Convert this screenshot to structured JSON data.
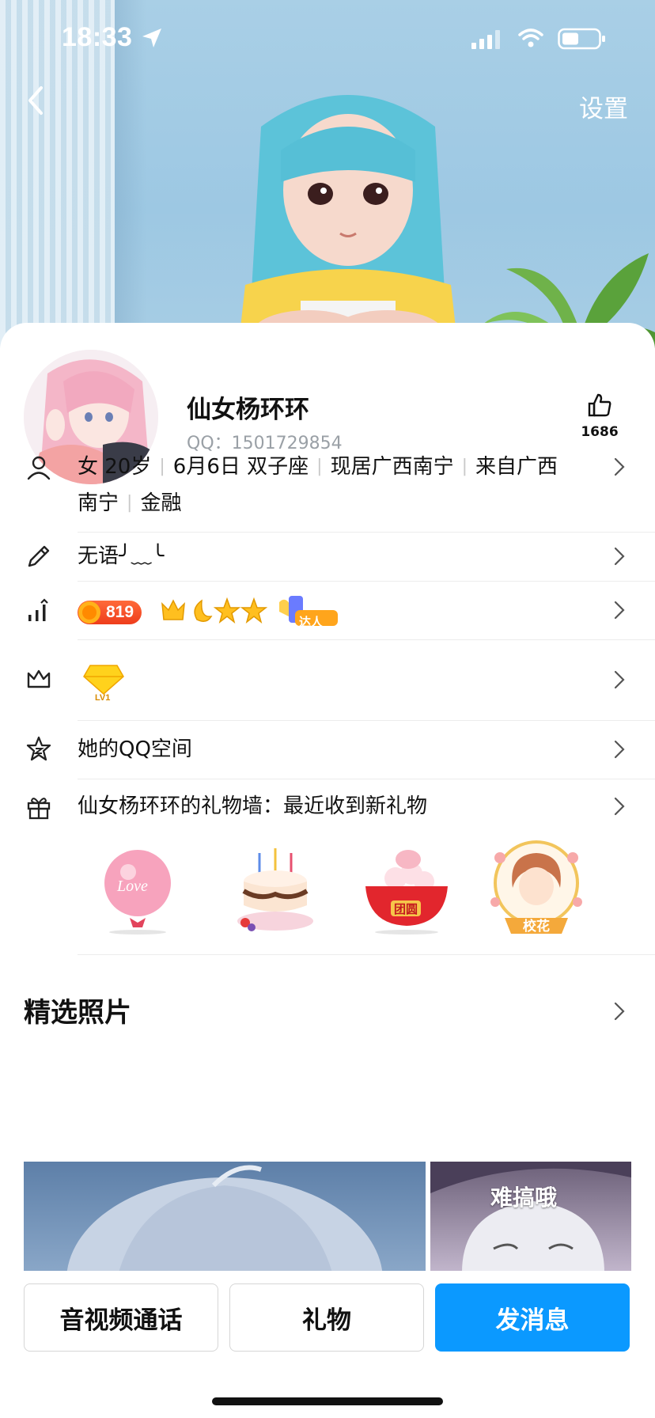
{
  "status_bar": {
    "time": "18:33"
  },
  "header": {
    "settings_label": "设置"
  },
  "profile": {
    "nickname": "仙女杨环环",
    "qq_label": "QQ：1501729854",
    "likes": "1686"
  },
  "info": {
    "parts": [
      "女 20岁",
      "6月6日 双子座",
      "现居广西南宁",
      "来自广西"
    ],
    "parts_line2": [
      "南宁",
      "金融"
    ]
  },
  "signature": "无语╯﹏╰",
  "level": {
    "value": "819",
    "talent_label": "达人",
    "vip_label": "LV1"
  },
  "qzone_label": "她的QQ空间",
  "gift_wall": {
    "title": "仙女杨环环的礼物墙：最近收到新礼物",
    "items": [
      {
        "name": "love-balloon",
        "text": "Love"
      },
      {
        "name": "birthday-cake",
        "text": ""
      },
      {
        "name": "tuanyuan-bowl",
        "text": "团圆"
      },
      {
        "name": "campus-belle",
        "text": "校花"
      }
    ]
  },
  "photos": {
    "title": "精选照片",
    "caption": "难搞哦"
  },
  "actions": {
    "call": "音视频通话",
    "gift": "礼物",
    "message": "发消息"
  },
  "colors": {
    "primary": "#0b99ff",
    "badge": "#ee3d1c",
    "text": "#111111",
    "muted": "#9aa0a6"
  }
}
